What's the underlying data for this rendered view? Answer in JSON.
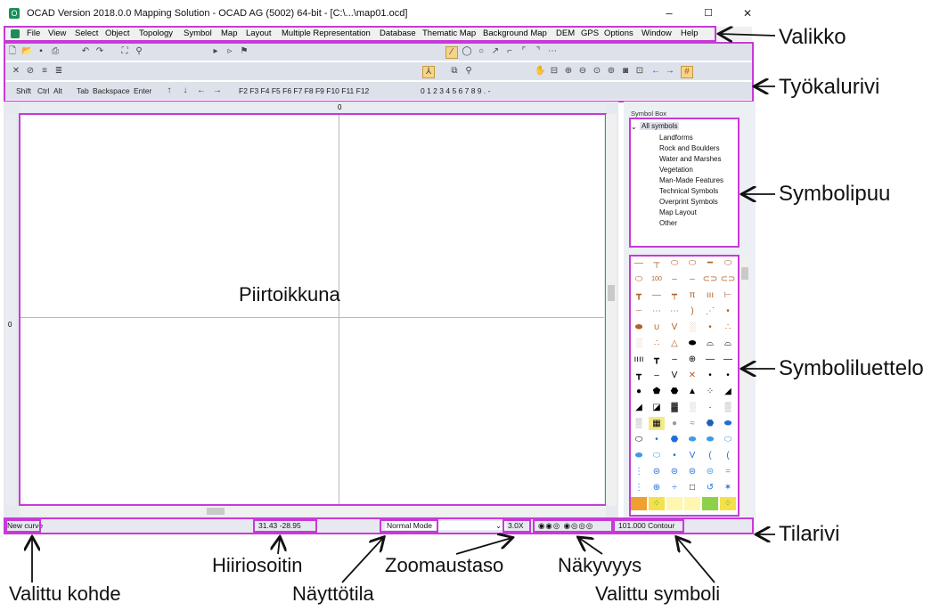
{
  "window": {
    "title": "OCAD Version 2018.0.0  Mapping Solution - OCAD AG (5002) 64-bit - [C:\\...\\map01.ocd]",
    "minimize": "–",
    "maximize": "☐",
    "close": "✕"
  },
  "menu": {
    "items": [
      "File",
      "View",
      "Select",
      "Object",
      "Topology",
      "Symbol",
      "Map",
      "Layout",
      "Multiple Representation",
      "Database",
      "Thematic Map",
      "Background Map",
      "DEM",
      "GPS",
      "Options",
      "Window",
      "Help"
    ]
  },
  "toolbar": {
    "keys_row": [
      "Shift",
      "Ctrl",
      "Alt",
      "Tab",
      "Backspace",
      "Enter"
    ],
    "fn_keys": "F2  F3  F4  F5  F6  F7  F8  F9  F10  F11  F12",
    "digits": "0  1  2  3  4  5  6  7  8  9  .  -"
  },
  "ruler": {
    "top_zero": "0",
    "left_zero": "0"
  },
  "canvas": {
    "label": "Piirtoikkuna"
  },
  "symbol_box": {
    "title": "Symbol Box",
    "root": "All symbols",
    "items": [
      "Landforms",
      "Rock and Boulders",
      "Water and Marshes",
      "Vegetation",
      "Man-Made Features",
      "Technical Symbols",
      "Overprint Symbols",
      "Map Layout",
      "Other"
    ]
  },
  "statusbar": {
    "selected_object": "New curve",
    "mouse_position": "31.43  -28.95",
    "display_mode": "Normal Mode",
    "zoom": "3.0X",
    "selected_symbol": "101.000 Contour"
  },
  "callouts": {
    "menu": "Valikko",
    "toolbar": "Työkalurivi",
    "symbol_tree": "Symbolipuu",
    "symbol_list": "Symboliluettelo",
    "statusbar": "Tilarivi",
    "selected_object": "Valittu kohde",
    "mouse_pointer": "Hiiriosoitin",
    "display_mode": "Näyttötila",
    "zoom_level": "Zoomaustaso",
    "visibility": "Näkyvyys",
    "selected_symbol": "Valittu symboli"
  },
  "colors": {
    "highlight": "#c73ad8",
    "accent_green": "#1b8e5a",
    "toolbar_bg": "#dce1ea"
  }
}
